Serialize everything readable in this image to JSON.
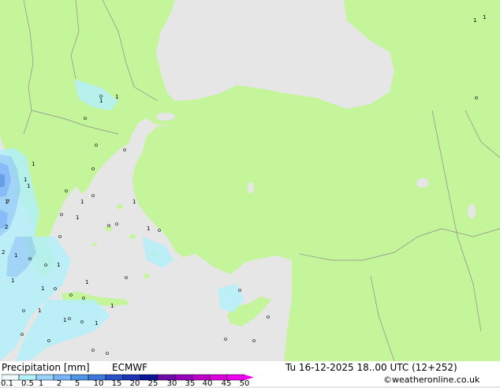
{
  "map": {
    "land_color": "#c5f59a",
    "sea_color": "#e6e6e6",
    "precip_colors": [
      "#b4f0fa",
      "#96d2fa",
      "#78b4fa",
      "#5096e6"
    ],
    "point_labels": [
      "1",
      "1",
      "1",
      "1",
      "7",
      "1",
      "2",
      "2",
      "1",
      "1",
      "1",
      "1",
      "1",
      "1",
      "1",
      "1",
      "1",
      "1",
      "1",
      "1",
      "1",
      "1",
      "1",
      "1"
    ]
  },
  "footer": {
    "title": "Precipitation [mm]",
    "model": "ECMWF",
    "valid_time": "Tu 16-12-2025 18..00 UTC (12+252)",
    "credit": "©weatheronline.co.uk",
    "scale_labels": [
      "0.1",
      "0.5",
      "1",
      "2",
      "5",
      "10",
      "15",
      "20",
      "25",
      "30",
      "35",
      "40",
      "45",
      "50"
    ],
    "scale_colors": [
      "#f0fafa",
      "#b4f0fa",
      "#96d2fa",
      "#78b4fa",
      "#5096e6",
      "#3c78dc",
      "#2850c8",
      "#1e32b4",
      "#0a1496",
      "#6e0aaa",
      "#9600be",
      "#be00c8",
      "#dc00dc",
      "#f000f0"
    ]
  }
}
